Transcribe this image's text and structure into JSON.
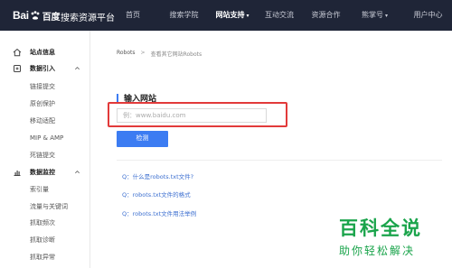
{
  "header": {
    "logo_prefix": "Bai",
    "logo_suffix": "百度",
    "platform": "搜索资源平台",
    "nav": [
      {
        "label": "首页"
      },
      {
        "label": "搜索学院"
      },
      {
        "label": "网站支持",
        "active": true,
        "arrow": "▾"
      },
      {
        "label": "互动交流"
      },
      {
        "label": "资源合作"
      },
      {
        "label": "熊掌号",
        "arrow": "▾"
      },
      {
        "label": "用户中心"
      }
    ]
  },
  "sidebar": {
    "items": [
      {
        "label": "站点信息",
        "type": "group",
        "icon": "home-icon"
      },
      {
        "label": "数据引入",
        "type": "group",
        "icon": "data-import-icon",
        "chevron": "^"
      },
      {
        "label": "链接提交",
        "type": "sub"
      },
      {
        "label": "原创保护",
        "type": "sub"
      },
      {
        "label": "移动适配",
        "type": "sub"
      },
      {
        "label": "MIP & AMP",
        "type": "sub"
      },
      {
        "label": "死链提交",
        "type": "sub"
      },
      {
        "label": "数据监控",
        "type": "group",
        "icon": "chart-icon",
        "chevron": "^"
      },
      {
        "label": "索引量",
        "type": "sub"
      },
      {
        "label": "流量与关键词",
        "type": "sub"
      },
      {
        "label": "抓取频次",
        "type": "sub"
      },
      {
        "label": "抓取诊断",
        "type": "sub"
      },
      {
        "label": "抓取异常",
        "type": "sub"
      }
    ]
  },
  "breadcrumb": {
    "root": "Robots",
    "separator": ">",
    "current": "查看其它网站Robots"
  },
  "main": {
    "section_title": "输入网站",
    "url_input": {
      "value": "",
      "placeholder": "例：www.baidu.com"
    },
    "check_button": "检测",
    "faqs": [
      "Q：什么是robots.txt文件?",
      "Q：robots.txt文件的格式",
      "Q：robots.txt文件用法举例"
    ]
  },
  "watermark": {
    "big": "百科全说",
    "small": "助你轻松解决"
  },
  "colors": {
    "topbar": "#1f2537",
    "accent": "#3c7cf2",
    "highlight": "#e23a3a",
    "watermark": "#1aa44b",
    "link": "#3c6fd0"
  }
}
